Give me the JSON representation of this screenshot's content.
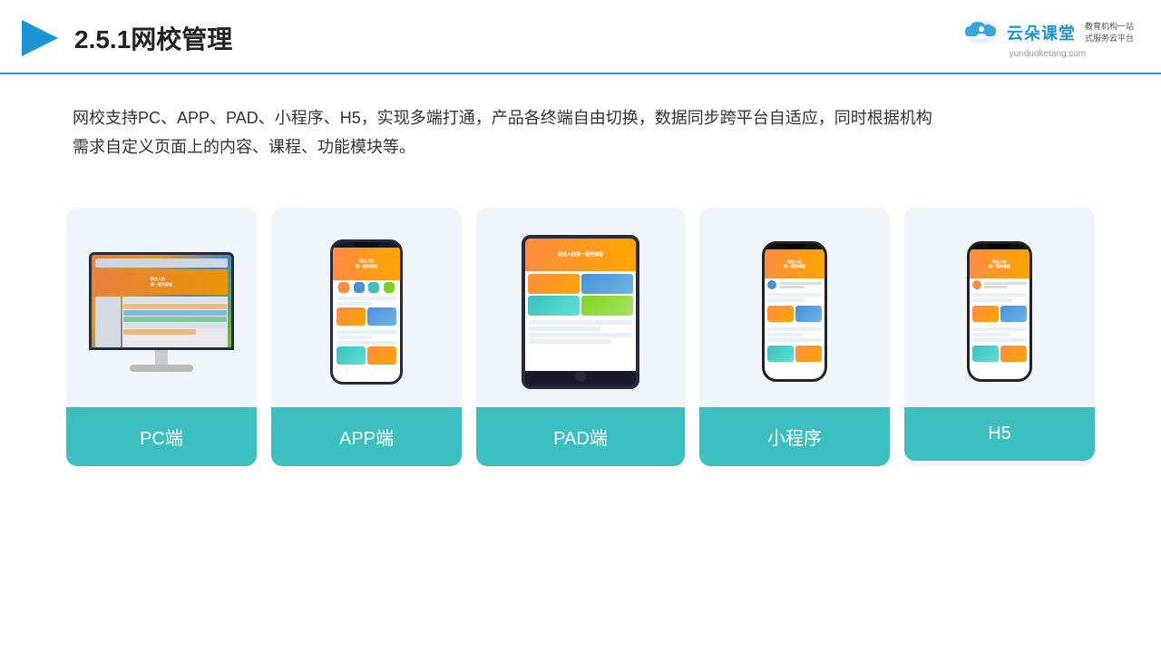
{
  "header": {
    "title": "2.5.1网校管理",
    "logo_text": "云朵课堂",
    "logo_sub": "教育机构一站\n式服务云平台",
    "logo_url": "yunduoketang.com"
  },
  "description": {
    "text": "网校支持PC、APP、PAD、小程序、H5，实现多端打通，产品各终端自由切换，数据同步跨平台自适应，同时根据机构\n需求自定义页面上的内容、课程、功能模块等。"
  },
  "cards": [
    {
      "id": "pc",
      "label": "PC端",
      "type": "pc"
    },
    {
      "id": "app",
      "label": "APP端",
      "type": "phone"
    },
    {
      "id": "pad",
      "label": "PAD端",
      "type": "tablet"
    },
    {
      "id": "miniprogram",
      "label": "小程序",
      "type": "mini-phone"
    },
    {
      "id": "h5",
      "label": "H5",
      "type": "mini-phone"
    }
  ],
  "colors": {
    "accent": "#3cbfbf",
    "header_line": "#1a96d4",
    "card_bg": "#f0f4fb",
    "label_bg": "#3cbfbf"
  }
}
